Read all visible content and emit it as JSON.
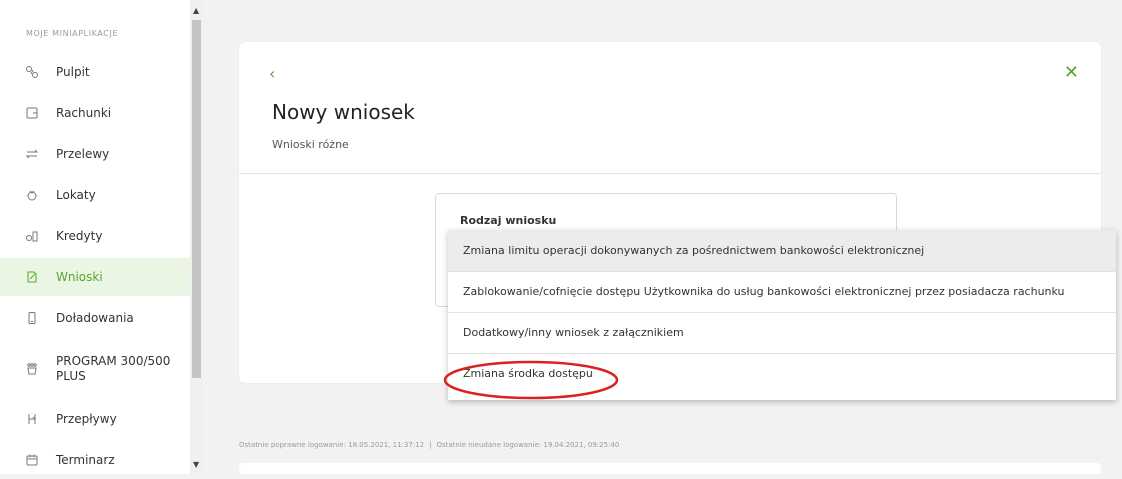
{
  "sidebar": {
    "header": "MOJE MINIAPLIKACJE",
    "items": [
      {
        "label": "Pulpit",
        "icon": "dashboard-icon"
      },
      {
        "label": "Rachunki",
        "icon": "accounts-icon"
      },
      {
        "label": "Przelewy",
        "icon": "transfers-icon"
      },
      {
        "label": "Lokaty",
        "icon": "deposits-icon"
      },
      {
        "label": "Kredyty",
        "icon": "loans-icon"
      },
      {
        "label": "Wnioski",
        "icon": "applications-icon",
        "active": true
      },
      {
        "label": "Doładowania",
        "icon": "topup-icon"
      },
      {
        "label": "PROGRAM 300/500 PLUS",
        "icon": "program-icon"
      },
      {
        "label": "Przepływy",
        "icon": "cashflow-icon"
      },
      {
        "label": "Terminarz",
        "icon": "calendar-icon"
      }
    ]
  },
  "card": {
    "title": "Nowy wniosek",
    "subtitle": "Wnioski różne",
    "field_label": "Rodzaj wniosku"
  },
  "dropdown": {
    "options": [
      "Zmiana limitu operacji dokonywanych za pośrednictwem bankowości elektronicznej",
      "Zablokowanie/cofnięcie dostępu Użytkownika do usług bankowości elektronicznej przez posiadacza rachunku",
      "Dodatkowy/inny wniosek z załącznikiem",
      "Zmiana środka dostępu"
    ],
    "highlighted_index": 0
  },
  "footer": {
    "last_login": "Ostatnie poprawne logowanie: 18.05.2021, 11:37:12",
    "separator": "|",
    "last_failed": "Ostatnie nieudane logowanie: 19.04.2021, 09:25:40"
  },
  "colors": {
    "accent": "#55a630",
    "annotation": "#d9231f"
  }
}
